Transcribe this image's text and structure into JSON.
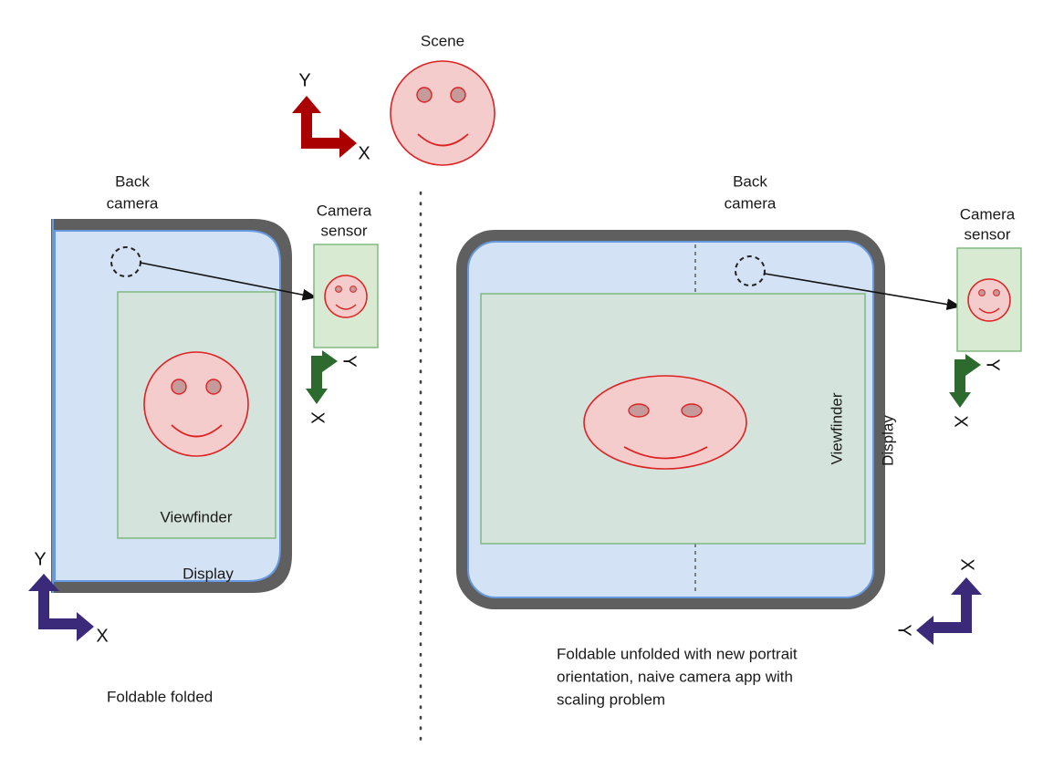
{
  "diagram": {
    "title_scene": "Scene",
    "divider": "vertical-dotted-separator"
  },
  "scene": {
    "label": "Scene",
    "axes": {
      "color": "#aa0000",
      "x_label": "X",
      "y_label": "Y",
      "x_direction": "right",
      "y_direction": "up"
    },
    "face": {
      "fill": "#f4cccc",
      "stroke": "#dd2222",
      "eye_fill": "#c49a9a",
      "shape": "circle"
    }
  },
  "left_panel": {
    "caption": "Foldable folded",
    "back_camera_label": "Back\ncamera",
    "back_camera_line1": "Back",
    "back_camera_line2": "camera",
    "display_label": "Display",
    "viewfinder_label": "Viewfinder",
    "camera_sensor_line1": "Camera",
    "camera_sensor_line2": "sensor",
    "device_axes": {
      "color": "#3b2a7a",
      "x_label": "X",
      "y_label": "Y",
      "x_direction": "right",
      "y_direction": "up"
    },
    "sensor_axes": {
      "color": "#2d6a2d",
      "x_label": "X",
      "y_label": "Y",
      "x_direction": "down",
      "y_direction": "right",
      "label_rotation_deg": 90
    },
    "colors": {
      "bezel": "#5f5f5f",
      "display_fill": "#d3e2f4",
      "display_stroke": "#6699e0",
      "viewfinder_fill": "#d5e3dd",
      "viewfinder_stroke": "#79b779",
      "sensor_fill": "#d9ead3",
      "sensor_stroke": "#79b779"
    },
    "face_shape": "circle"
  },
  "right_panel": {
    "caption_line1": "Foldable unfolded with new portrait",
    "caption_line2": "orientation, naive camera app with",
    "caption_line3": "scaling problem",
    "back_camera_line1": "Back",
    "back_camera_line2": "camera",
    "display_label": "Display",
    "viewfinder_label": "Viewfinder",
    "camera_sensor_line1": "Camera",
    "camera_sensor_line2": "sensor",
    "label_rotation_deg": 90,
    "device_axes": {
      "color": "#3b2a7a",
      "x_label": "X",
      "y_label": "Y",
      "x_direction": "up",
      "y_direction": "left",
      "label_rotation_deg": 90
    },
    "sensor_axes": {
      "color": "#2d6a2d",
      "x_label": "X",
      "y_label": "Y",
      "x_direction": "down",
      "y_direction": "right",
      "label_rotation_deg": 90
    },
    "fold_line": "dashed-vertical-fold",
    "face_shape": "ellipse-stretched-horizontally"
  }
}
